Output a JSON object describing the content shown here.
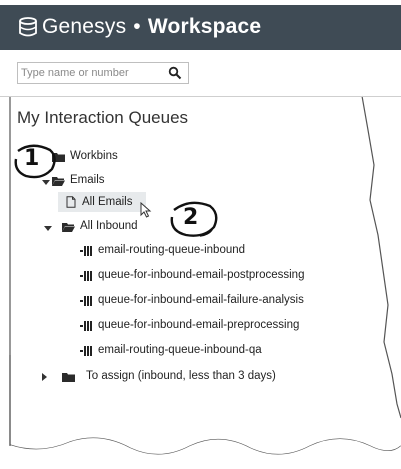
{
  "header": {
    "brand": "Genesys",
    "separator": "•",
    "product": "Workspace"
  },
  "search": {
    "placeholder": "Type name or number"
  },
  "section": {
    "title": "My Interaction Queues"
  },
  "tree": {
    "workbins_label": "Workbins",
    "emails_label": "Emails",
    "all_emails_label": "All Emails",
    "all_inbound_label": "All Inbound",
    "queues": [
      "email-routing-queue-inbound",
      "queue-for-inbound-email-postprocessing",
      "queue-for-inbound-email-failure-analysis",
      "queue-for-inbound-email-preprocessing",
      "email-routing-queue-inbound-qa"
    ],
    "to_assign_label": "To assign (inbound, less than 3 days)"
  },
  "callouts": {
    "one": "1",
    "two": "2"
  },
  "colors": {
    "header_bg": "#3f4b55",
    "selected_bg": "#e7eaec"
  }
}
